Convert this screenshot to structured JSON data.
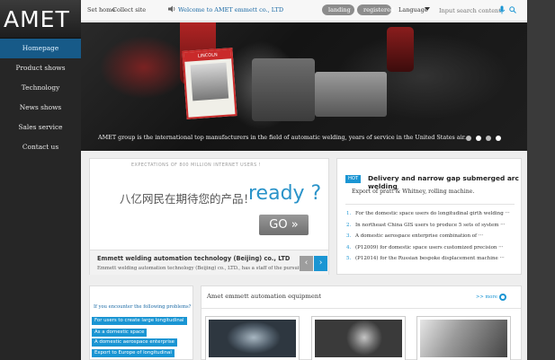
{
  "brand": {
    "logo": "AMET"
  },
  "sidebar": {
    "items": [
      {
        "label": "Homepage"
      },
      {
        "label": "Product shows"
      },
      {
        "label": "Technology"
      },
      {
        "label": "News shows"
      },
      {
        "label": "Sales service"
      },
      {
        "label": "Contact us"
      }
    ]
  },
  "topbar": {
    "set_home": "Set home",
    "collect": "Collect site",
    "welcome": "Welcome to AMET emmett co., LTD",
    "landing": "landing",
    "registered": "registered",
    "language": "Language",
    "search_placeholder": "Input search content"
  },
  "banner": {
    "caption": "AMET group is the international top manufacturers in the field of automatic welding, years of service in the United States air...",
    "sign_label": "LINCOLN",
    "dots": 4,
    "active_dot": 1
  },
  "ad": {
    "tag": "EXPECTATIONS OF 800 MILLION INTERNET USERS !",
    "chinese": "八亿网民在期待您的产品！",
    "ready": "ready ?",
    "go": "GO »",
    "title": "Emmett welding automation technology (Beijing) co., LTD",
    "desc": "Emmett welding automation technology (Beijing) co., LTD., has a staff of the pursuit ······",
    "prev": "‹",
    "next": "›"
  },
  "news": {
    "hot": "HOT",
    "headline": "Delivery and narrow gap submerged arc welding",
    "subline": "Export of pratt & Whitney, rolling machine.",
    "items": [
      {
        "num": "1.",
        "text": "For the domestic space users do longitudinal girth welding ···"
      },
      {
        "num": "2.",
        "text": "In northeast China GIS users to produce 5 sets of system ···"
      },
      {
        "num": "3.",
        "text": "A domestic aerospace enterprise combination of ···"
      },
      {
        "num": "4.",
        "text": "(P12009) for domestic space users customized precision ···"
      },
      {
        "num": "5.",
        "text": "(P12014) for the Russian bespoke displacement machine ···"
      }
    ]
  },
  "problems": {
    "title": "If you encounter the following problems?",
    "tags": [
      "For users to create large longitudinal",
      "As a domestic space",
      "A domestic aerospace enterprise",
      "Export to Europe of longitudinal"
    ]
  },
  "equipment": {
    "heading": "Amet emmett automation equipment",
    "more": ">> more"
  },
  "colors": {
    "accent": "#1a95d3",
    "nav_active": "#175a88",
    "sidebar_bg": "#262626"
  }
}
